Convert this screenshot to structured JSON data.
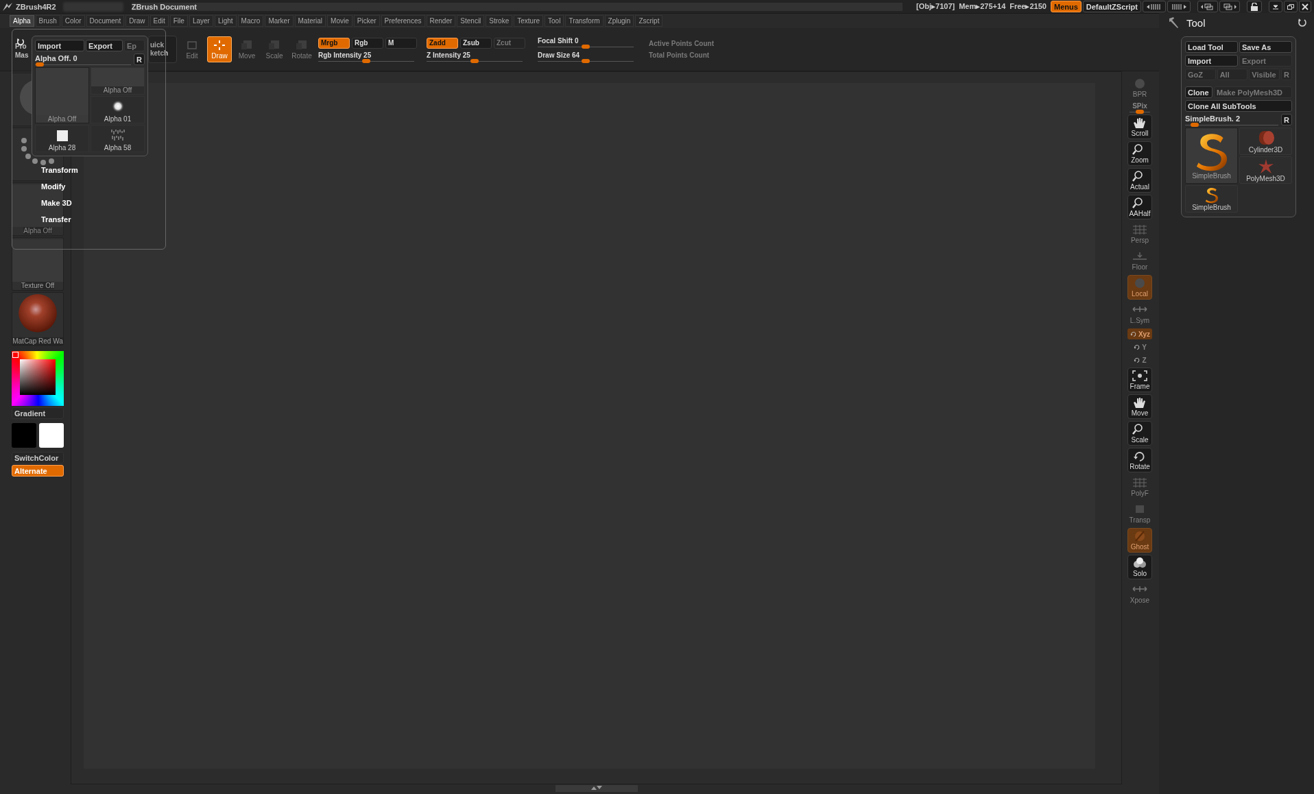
{
  "title_bar": {
    "app": "ZBrush4R2",
    "document": "ZBrush Document",
    "stats": [
      "[Obj▸7107]",
      "Mem▸275+14",
      "Free▸2150"
    ]
  },
  "top_buttons": [
    {
      "label": "Menus",
      "selected": true
    },
    {
      "label": "DefaultZScript",
      "selected": false
    }
  ],
  "menu": [
    {
      "label": "Alpha",
      "selected": true
    },
    {
      "label": "Brush",
      "selected": false
    },
    {
      "label": "Color",
      "selected": false
    },
    {
      "label": "Document",
      "selected": false
    },
    {
      "label": "Draw",
      "selected": false
    },
    {
      "label": "Edit",
      "selected": false
    },
    {
      "label": "File",
      "selected": false
    },
    {
      "label": "Layer",
      "selected": false
    },
    {
      "label": "Light",
      "selected": false
    },
    {
      "label": "Macro",
      "selected": false
    },
    {
      "label": "Marker",
      "selected": false
    },
    {
      "label": "Material",
      "selected": false
    },
    {
      "label": "Movie",
      "selected": false
    },
    {
      "label": "Picker",
      "selected": false
    },
    {
      "label": "Preferences",
      "selected": false
    },
    {
      "label": "Render",
      "selected": false
    },
    {
      "label": "Stencil",
      "selected": false
    },
    {
      "label": "Stroke",
      "selected": false
    },
    {
      "label": "Texture",
      "selected": false
    },
    {
      "label": "Tool",
      "selected": false
    },
    {
      "label": "Transform",
      "selected": false
    },
    {
      "label": "Zplugin",
      "selected": false
    },
    {
      "label": "Zscript",
      "selected": false
    }
  ],
  "toolbar": {
    "cut_labels": [
      "Pro",
      "Mas"
    ],
    "quick_sketch": [
      "uick",
      "ketch"
    ],
    "modes": [
      {
        "label": "Edit",
        "selected": false,
        "disabled": true
      },
      {
        "label": "Draw",
        "selected": true,
        "disabled": false
      },
      {
        "label": "Move",
        "selected": false,
        "disabled": true
      },
      {
        "label": "Scale",
        "selected": false,
        "disabled": true
      },
      {
        "label": "Rotate",
        "selected": false,
        "disabled": true
      }
    ],
    "color_modes": [
      {
        "label": "Mrgb",
        "on": true,
        "disabled": false
      },
      {
        "label": "Rgb",
        "on": false,
        "disabled": false
      },
      {
        "label": "M",
        "on": false,
        "disabled": false
      }
    ],
    "rgb_intensity": {
      "label": "Rgb Intensity 25",
      "level": 0.5
    },
    "depth_modes": [
      {
        "label": "Zadd",
        "on": true,
        "disabled": false
      },
      {
        "label": "Zsub",
        "on": false,
        "disabled": false
      },
      {
        "label": "Zcut",
        "on": false,
        "disabled": true
      }
    ],
    "z_intensity": {
      "label": "Z Intensity 25",
      "level": 0.5
    },
    "focal_shift": {
      "label": "Focal Shift 0",
      "level": 0.5
    },
    "draw_size": {
      "label": "Draw Size 64",
      "level": 0.5
    },
    "counts": [
      "Active Points Count",
      "Total Points Count"
    ]
  },
  "alpha_popup": {
    "buttons": [
      {
        "label": "Import",
        "disabled": false
      },
      {
        "label": "Export",
        "disabled": false
      },
      {
        "label": "Ep",
        "disabled": true
      }
    ],
    "slider": {
      "label": "Alpha Off. 0",
      "level": 0.05
    },
    "reset": "R",
    "alphas": [
      {
        "label": "Alpha Off",
        "kind": "off",
        "selected": false
      },
      {
        "label": "Alpha Off",
        "kind": "off",
        "selected": true
      },
      {
        "label": "Alpha 01",
        "kind": "radial",
        "selected": false
      },
      {
        "label": "Alpha 28",
        "kind": "square",
        "selected": false
      },
      {
        "label": "Alpha 58",
        "kind": "noise",
        "selected": false
      }
    ],
    "menu": [
      "Transform",
      "Modify",
      "Make 3D",
      "Transfer"
    ]
  },
  "left_shelf": {
    "thumbnails": [
      {
        "kind": "brush"
      },
      {
        "kind": "stroke"
      },
      {
        "kind": "alpha",
        "label": "Alpha Off"
      },
      {
        "kind": "texture",
        "label": "Texture Off"
      },
      {
        "kind": "material",
        "label": "MatCap Red Wa"
      }
    ],
    "color": "#ff0000",
    "gradient": {
      "label": "Gradient",
      "on": false
    },
    "swatches": [
      {
        "color": "#000000"
      },
      {
        "color": "#ffffff"
      }
    ],
    "buttons": [
      {
        "label": "SwitchColor",
        "on": false
      },
      {
        "label": "Alternate",
        "on": true
      }
    ]
  },
  "right_shelf": [
    {
      "label": "BPR",
      "kind": "button",
      "disabled": true,
      "on": false
    },
    {
      "label": "SPix",
      "kind": "slider",
      "level": 0.5
    },
    {
      "label": "Scroll",
      "kind": "button",
      "disabled": false,
      "on": false
    },
    {
      "label": "Zoom",
      "kind": "button",
      "disabled": false,
      "on": false
    },
    {
      "label": "Actual",
      "kind": "button",
      "disabled": false,
      "on": false
    },
    {
      "label": "AAHalf",
      "kind": "button",
      "disabled": false,
      "on": false
    },
    {
      "label": "Persp",
      "kind": "button",
      "disabled": true,
      "on": false
    },
    {
      "label": "Floor",
      "kind": "button",
      "disabled": true,
      "on": false
    },
    {
      "label": "Local",
      "kind": "button",
      "disabled": true,
      "on": true
    },
    {
      "label": "L.Sym",
      "kind": "button",
      "disabled": true,
      "on": false
    },
    {
      "label": "Xyz",
      "kind": "mini",
      "disabled": true,
      "on": true
    },
    {
      "label": "Y",
      "kind": "mini",
      "disabled": true,
      "on": false
    },
    {
      "label": "Z",
      "kind": "mini",
      "disabled": true,
      "on": false
    },
    {
      "label": "Frame",
      "kind": "button",
      "disabled": false,
      "on": false
    },
    {
      "label": "Move",
      "kind": "button",
      "disabled": false,
      "on": false
    },
    {
      "label": "Scale",
      "kind": "button",
      "disabled": false,
      "on": false
    },
    {
      "label": "Rotate",
      "kind": "button",
      "disabled": false,
      "on": false
    },
    {
      "label": "PolyF",
      "kind": "button",
      "disabled": true,
      "on": false
    },
    {
      "label": "Transp",
      "kind": "button",
      "disabled": true,
      "on": false
    },
    {
      "label": "Ghost",
      "kind": "button",
      "disabled": true,
      "on": true
    },
    {
      "label": "Solo",
      "kind": "button",
      "disabled": false,
      "on": false
    },
    {
      "label": "Xpose",
      "kind": "button",
      "disabled": true,
      "on": false
    }
  ],
  "tool_panel": {
    "title": "Tool",
    "rows": [
      [
        {
          "label": "Load Tool",
          "disabled": false
        },
        {
          "label": "Save As",
          "disabled": false
        }
      ],
      [
        {
          "label": "Import",
          "disabled": false
        },
        {
          "label": "Export",
          "disabled": true
        }
      ],
      [
        {
          "label": "GoZ",
          "disabled": true
        },
        {
          "label": "All",
          "disabled": true
        },
        {
          "label": "Visible",
          "disabled": true
        },
        {
          "label": "R",
          "disabled": true
        }
      ],
      [
        {
          "label": "Clone",
          "disabled": false
        },
        {
          "label": "Make PolyMesh3D",
          "disabled": true
        }
      ],
      [
        {
          "label": "Clone All SubTools",
          "disabled": false
        }
      ]
    ],
    "slider": {
      "label": "SimpleBrush. 2",
      "level": 0.1
    },
    "reset": "R",
    "tools": [
      {
        "label": "Cylinder3D",
        "kind": "cylinder",
        "selected": false
      },
      {
        "label": "SimpleBrush",
        "kind": "brush",
        "selected": true
      },
      {
        "label": "PolyMesh3D",
        "kind": "star",
        "selected": false
      },
      {
        "label": "SimpleBrush",
        "kind": "brush",
        "selected": false
      }
    ]
  }
}
